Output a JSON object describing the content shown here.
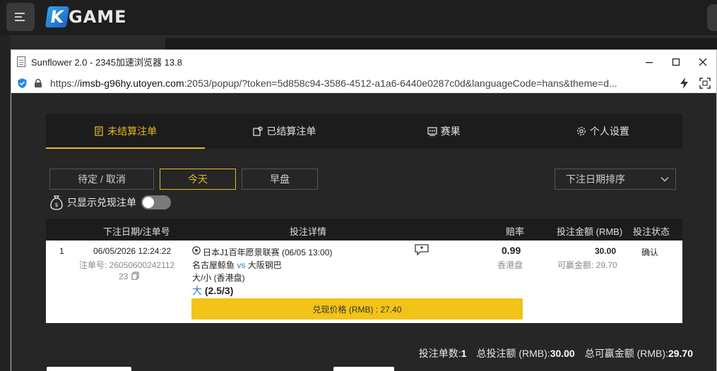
{
  "app": {
    "logo_text": "GAME",
    "logo_k": "K"
  },
  "window": {
    "title": "Sunflower 2.0 - 2345加速浏览器 13.8",
    "url_scheme": "https://",
    "url_host": "imsb-g96hy.utoyen.com",
    "url_rest": ":2053/popup/?token=5d858c94-3586-4512-a1a6-6440e0287c0d&languageCode=hans&theme=d..."
  },
  "tabs": [
    {
      "label": "未结算注单",
      "icon": "bet-slip-icon",
      "active": true
    },
    {
      "label": "已结算注单",
      "icon": "settled-icon",
      "active": false
    },
    {
      "label": "赛果",
      "icon": "scoreboard-icon",
      "active": false
    },
    {
      "label": "个人设置",
      "icon": "gear-icon",
      "active": false
    }
  ],
  "filters": {
    "pending": "待定 / 取消",
    "today": "今天",
    "early": "早盘",
    "sort_label": "下注日期排序"
  },
  "cashout_only": {
    "label": "只显示兑现注单",
    "enabled": false
  },
  "table": {
    "headers": {
      "date": "下注日期/注单号",
      "detail": "投注详情",
      "odds": "赔率",
      "stake": "投注金额 (RMB)",
      "status": "投注状态"
    },
    "rows": [
      {
        "index": "1",
        "date": "06/05/2026 12:24:22",
        "ticket_prefix": "注单号: 26050600242112",
        "ticket_suffix": "23",
        "league": "日本J1百年愿景联赛 (06/05 13:00)",
        "home": "名古屋鲸鱼",
        "vs": "vs",
        "away": "大阪钢巴",
        "market": "大/小 (香港盘)",
        "pick": "大",
        "line": "(2.5/3)",
        "odds": "0.99",
        "odds_type": "香港盘",
        "stake": "30.00",
        "win_label": "可赢金额: 29.70",
        "status": "确认",
        "cashout_label": "兑现价格 (RMB) : 27.40"
      }
    ]
  },
  "summary": {
    "count_label": "投注单数:",
    "count": "1",
    "total_label": "总投注额 (RMB):",
    "total": "30.00",
    "win_label": "总可赢金额 (RMB):",
    "win": "29.70"
  },
  "colors": {
    "accent": "#e6b722",
    "cashout_button": "#f2c318",
    "page_bg": "#262626",
    "header_bg": "#1c1c1c"
  }
}
